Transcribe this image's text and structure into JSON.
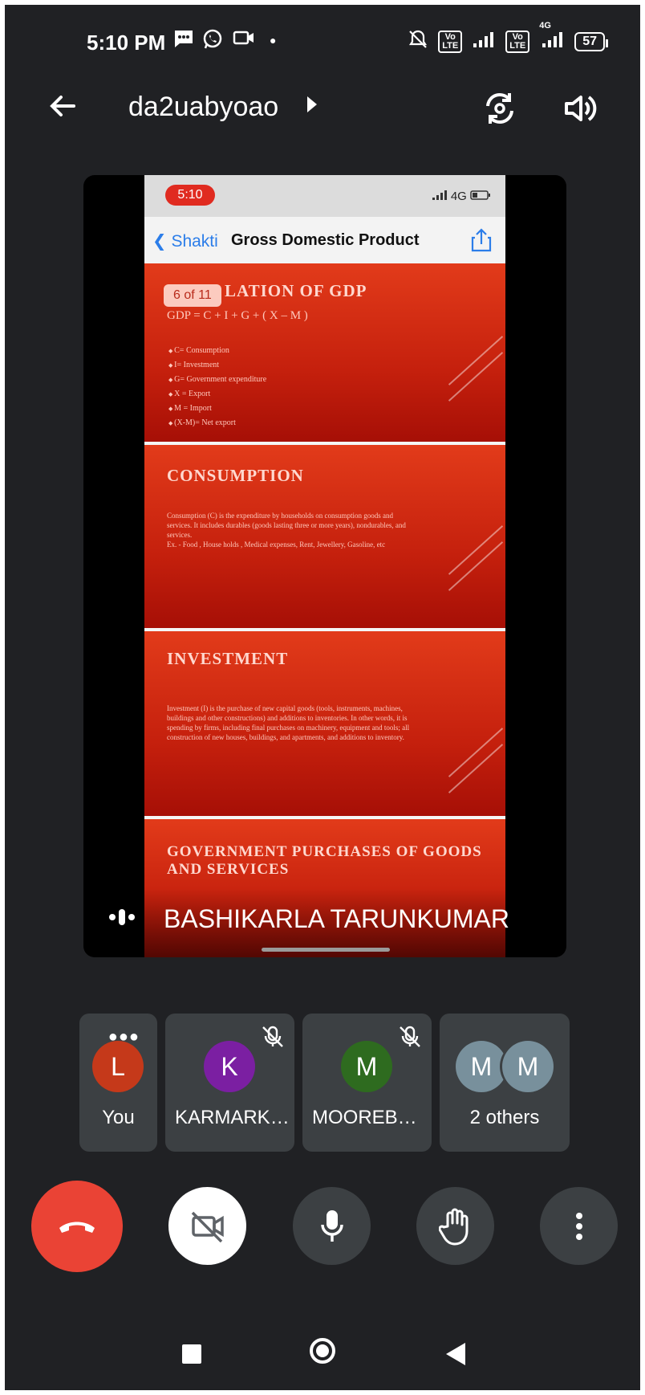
{
  "status_bar": {
    "time": "5:10 PM",
    "lte1": "Vo\nLTE",
    "lte2": "Vo\nLTE",
    "network": "4G",
    "battery": "57"
  },
  "header": {
    "meeting_code": "da2uabyoao"
  },
  "shared_screen": {
    "phone_time": "5:10",
    "phone_network": "4G",
    "back_label": "Shakti",
    "doc_title": "Gross Domestic Product",
    "page_indicator": "6 of 11",
    "slides": [
      {
        "heading": "LATION OF GDP",
        "formula": "GDP = C + I + G + ( X – M )",
        "bullets": [
          "C= Consumption",
          "I= Investment",
          "G= Government expenditure",
          "X = Export",
          "M = Import",
          "(X-M)= Net export"
        ]
      },
      {
        "heading": "CONSUMPTION",
        "body": "Consumption (C) is the expenditure by households on consumption goods and services. It includes durables (goods lasting three or more years), nondurables, and services.",
        "example": "Ex. - Food , House holds , Medical expenses, Rent, Jewellery, Gasoline, etc"
      },
      {
        "heading": "INVESTMENT",
        "body": "Investment (I) is the purchase of new capital goods (tools, instruments, machines, buildings and other constructions) and additions to inventories. In other words, it is spending by firms, including final purchases on machinery, equipment and tools; all construction of new houses, buildings, and apartments, and additions to inventory."
      },
      {
        "heading": "GOVERNMENT PURCHASES OF GOODS AND SERVICES"
      }
    ],
    "presenter_name": "BASHIKARLA TARUNKUMAR"
  },
  "participants": [
    {
      "initial": "L",
      "name": "You",
      "color": "#c5391a"
    },
    {
      "initial": "K",
      "name": "KARMARK…",
      "color": "#7b1fa2"
    },
    {
      "initial": "M",
      "name": "MOOREB…",
      "color": "#2e6b1f"
    },
    {
      "initial": "M",
      "initial2": "M",
      "name": "2 others",
      "color": "#78909c"
    }
  ],
  "colors": {
    "background": "#202124",
    "tile": "#3c4043",
    "end_call": "#ea4335"
  }
}
